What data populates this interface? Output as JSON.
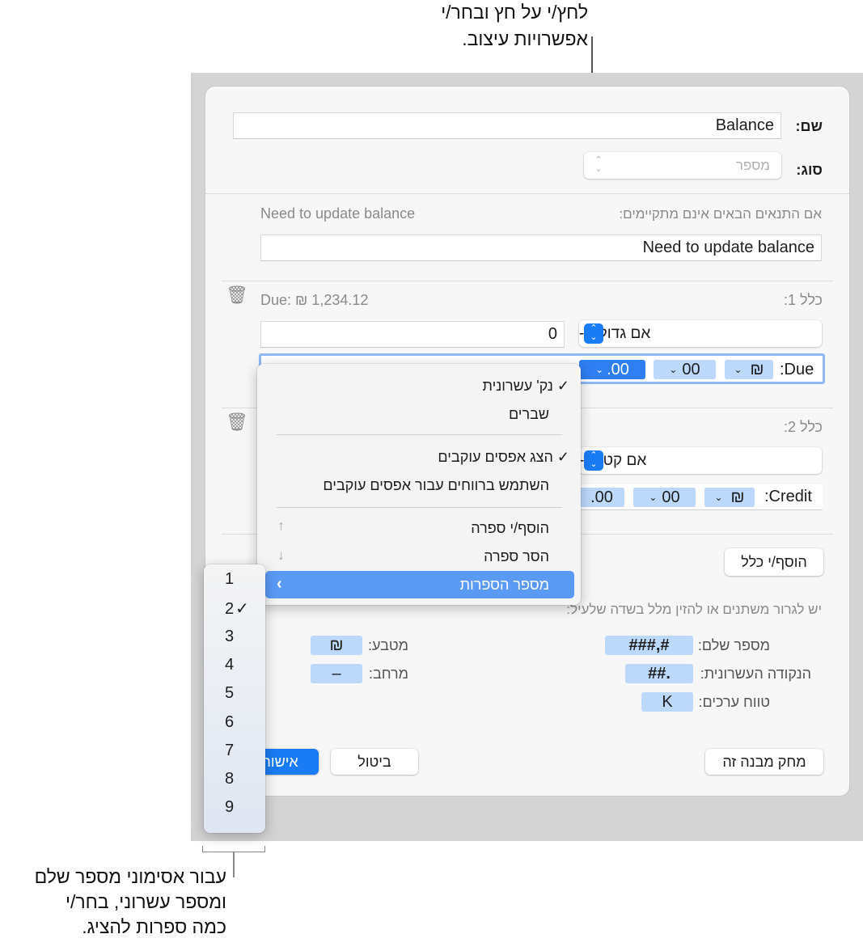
{
  "callouts": {
    "top": [
      "לחץ/י על חץ ובחר/י",
      "אפשרויות עיצוב."
    ],
    "bottom": [
      "עבור אסימוני מספר שלם",
      "ומספר עשרוני, בחר/י",
      "כמה ספרות להציג."
    ]
  },
  "form": {
    "name_label": "שם:",
    "name_value": "Balance",
    "type_label": "סוג:",
    "type_value": "מספר",
    "condition_label": "אם התנאים הבאים אינם מתקיימים:",
    "condition_preview": "Need to update balance",
    "condition_value": "Need to update balance"
  },
  "rules": [
    {
      "label": "כלל 1:",
      "preview": "Due: ₪ 1,234.12",
      "operator": "אם גדול מ-",
      "value": "0",
      "tokens": [
        ".00",
        "00",
        "₪"
      ],
      "prefix": ":Due"
    },
    {
      "label": "כלל 2:",
      "operator": "אם קטן מ-",
      "tokens": [
        ".00",
        "00",
        "₪"
      ],
      "prefix": ":Credit"
    }
  ],
  "add_rule": "הוסף/י כלל",
  "hint": "יש לגרור משתנים או להזין מלל בשדה שלעיל:",
  "token_palette": [
    {
      "label": "מספר שלם:",
      "token": "###,#"
    },
    {
      "label": "הנקודה העשרונית:",
      "token": "##."
    },
    {
      "label": "טווח ערכים:",
      "token": "K"
    },
    {
      "label": "מטבע:",
      "token": "₪"
    },
    {
      "label": "מרחב:",
      "token": "–"
    }
  ],
  "buttons": {
    "delete": "מחק מבנה זה",
    "cancel": "ביטול",
    "ok": "אישור"
  },
  "menu": {
    "items": [
      {
        "label": "נק' עשרונית",
        "checked": true
      },
      {
        "label": "שברים",
        "checked": false
      },
      {
        "label": "הצג אפסים עוקבים",
        "checked": true
      },
      {
        "label": "השתמש ברווחים עבור אפסים עוקבים",
        "checked": false
      },
      {
        "label": "הוסף/י ספרה",
        "icon": "arrow-up-icon"
      },
      {
        "label": "הסר ספרה",
        "icon": "arrow-down-icon"
      },
      {
        "label": "מספר הספרות",
        "highlighted": true,
        "icon": "chevron-left-icon"
      }
    ]
  },
  "submenu": {
    "items": [
      "1",
      "2",
      "3",
      "4",
      "5",
      "6",
      "7",
      "8",
      "9"
    ],
    "selected": "2"
  },
  "colors": {
    "accent": "#2f7ef2",
    "token": "#bcd8fb",
    "highlight": "#5a9af5"
  }
}
